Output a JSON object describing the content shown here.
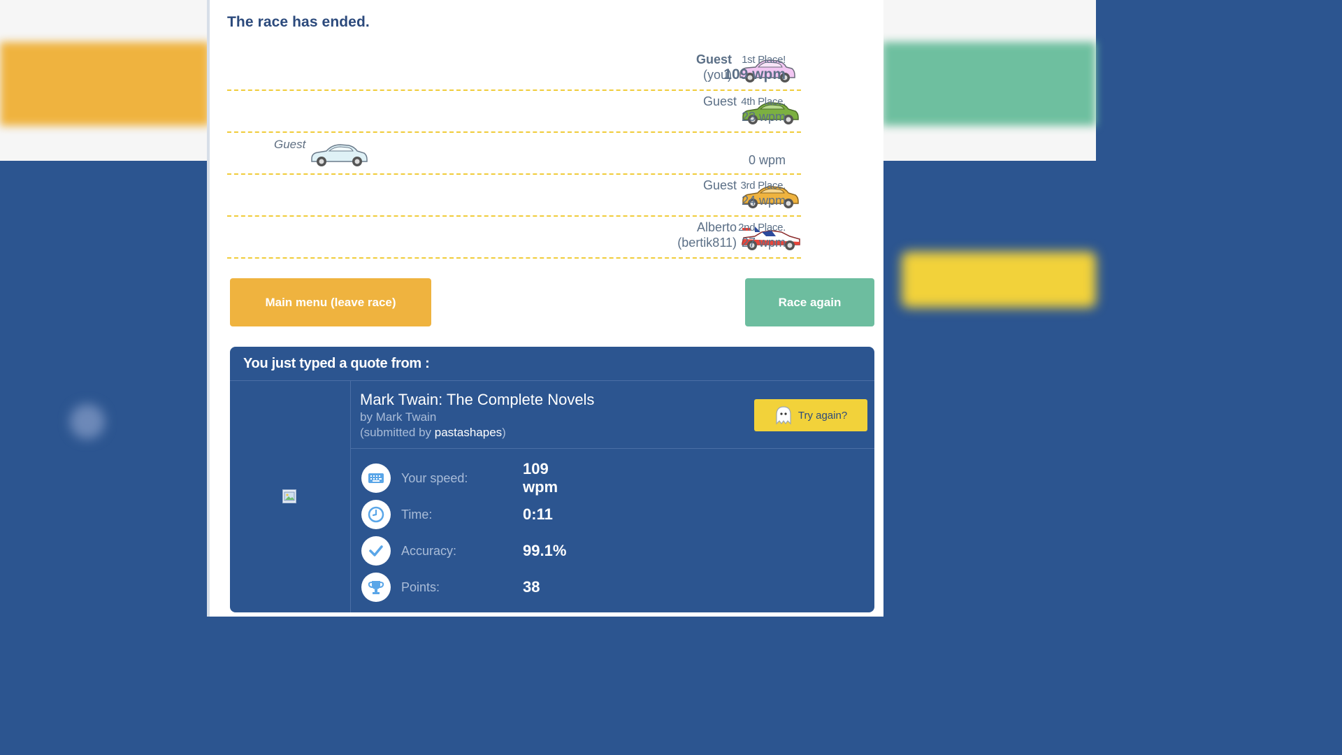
{
  "title": "The race has ended.",
  "racers": [
    {
      "name_line1": "Guest",
      "name_line2": "(you)",
      "place": "1st Place!",
      "wpm": "109 wpm",
      "car_color": "#f2c6f2"
    },
    {
      "name_line1": "Guest",
      "name_line2": "",
      "place": "4th Place.",
      "wpm": "23 wpm",
      "car_color": "#7cb041"
    },
    {
      "name_line1": "Guest",
      "name_line2": "",
      "place": "",
      "wpm": "0 wpm",
      "car_color": "#dff1f6"
    },
    {
      "name_line1": "Guest",
      "name_line2": "",
      "place": "3rd Place.",
      "wpm": "24 wpm",
      "car_color": "#efb33f"
    },
    {
      "name_line1": "Alberto",
      "name_line2": "(bertik811)",
      "place": "2nd Place.",
      "wpm": "27 wpm",
      "car_color": "#e9453a"
    }
  ],
  "buttons": {
    "main_menu": "Main menu (leave race)",
    "race_again": "Race again",
    "try_again": "Try again?"
  },
  "quote": {
    "header": "You just typed a quote from :",
    "book_title": "Mark Twain: The Complete Novels",
    "author": "by Mark Twain",
    "submitted_prefix": "(submitted by ",
    "submitted_user": "pastashapes",
    "submitted_suffix": ")"
  },
  "stats": [
    {
      "label": "Your speed:",
      "value": "109 wpm",
      "icon": "keyboard-icon"
    },
    {
      "label": "Time:",
      "value": "0:11",
      "icon": "clock-icon"
    },
    {
      "label": "Accuracy:",
      "value": "99.1%",
      "icon": "check-icon"
    },
    {
      "label": "Points:",
      "value": "38",
      "icon": "trophy-icon"
    }
  ],
  "colors": {
    "orange": "#efb33f",
    "green": "#6dbd9f",
    "blue": "#2c5590",
    "yellow": "#f2d23a"
  }
}
